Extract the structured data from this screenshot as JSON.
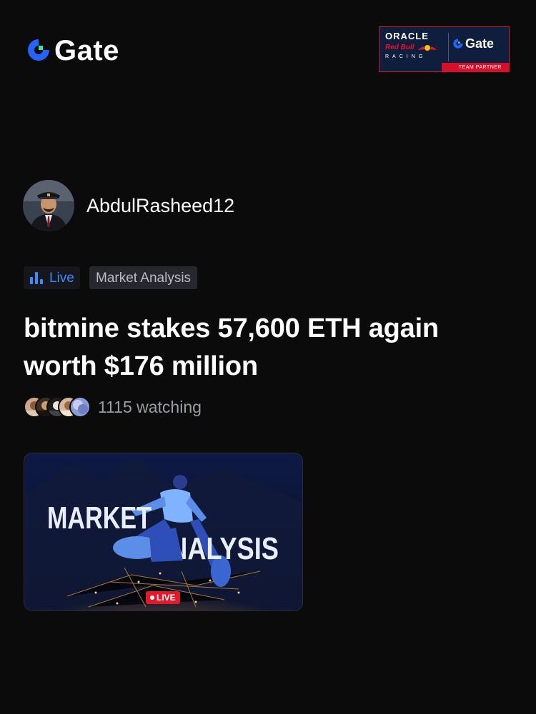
{
  "header": {
    "logo_text": "Gate",
    "partner": {
      "oracle": "ORACLE",
      "redbull": "Red Bull",
      "racing": "RACING",
      "gate": "Gate",
      "team_partner": "TEAM PARTNER"
    }
  },
  "author": {
    "name": "AbdulRasheed12"
  },
  "tags": {
    "live": "Live",
    "category": "Market Analysis"
  },
  "post": {
    "headline": "bitmine stakes 57,600 ETH again worth $176 million"
  },
  "watchers": {
    "text": "1115 watching"
  },
  "thumbnail": {
    "title_line1": "MARKET",
    "title_line2": "ANALYSIS",
    "badge": "LIVE"
  },
  "colors": {
    "background": "#0b0b0c",
    "accent_blue": "#3d8cff",
    "gate_green": "#2ee59d",
    "live_red": "#e11a2a"
  }
}
